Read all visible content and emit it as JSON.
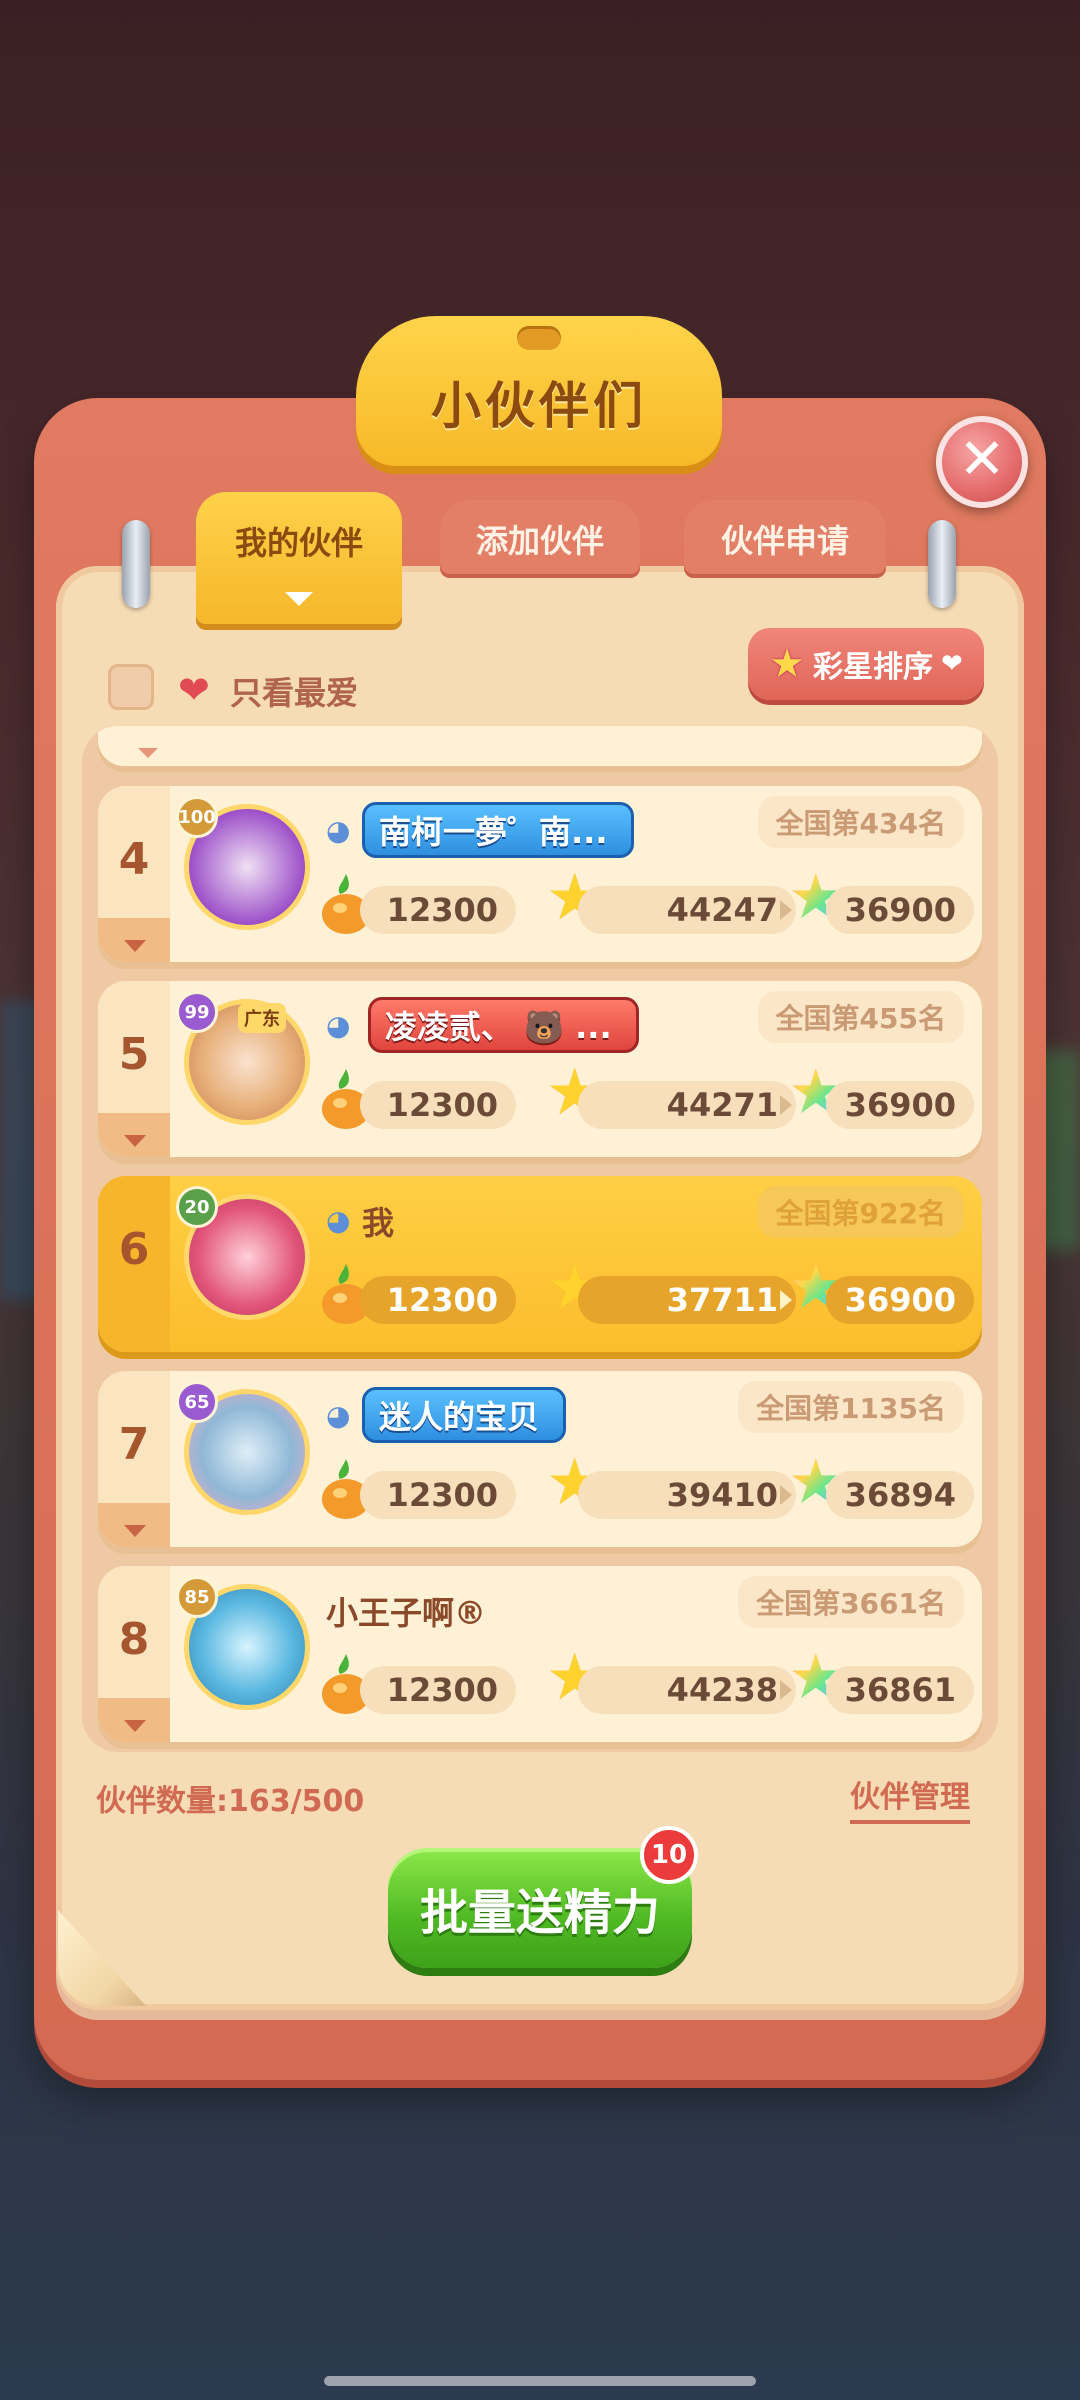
{
  "title": "小伙伴们",
  "close_label": "✕",
  "tabs": [
    {
      "label": "我的伙伴",
      "active": true
    },
    {
      "label": "添加伙伴",
      "active": false
    },
    {
      "label": "伙伴申请",
      "active": false
    }
  ],
  "filter": {
    "label": "只看最爱",
    "checked": false
  },
  "sort_button": {
    "label": "彩星排序"
  },
  "partners": [
    {
      "rank": "4",
      "level": "100",
      "name": "南柯一夢゜南...",
      "national_rank": "全国第434名",
      "energy": "12300",
      "stars": "44247",
      "rainbow_stars": "36900",
      "is_me": false
    },
    {
      "rank": "5",
      "level": "99",
      "name": "凌凌贰、 🐻 ...",
      "national_rank": "全国第455名",
      "energy": "12300",
      "stars": "44271",
      "rainbow_stars": "36900",
      "is_me": false,
      "region_tag": "广东"
    },
    {
      "rank": "6",
      "level": "20",
      "name": "我",
      "national_rank": "全国第922名",
      "energy": "12300",
      "stars": "37711",
      "rainbow_stars": "36900",
      "is_me": true
    },
    {
      "rank": "7",
      "level": "65",
      "name": "迷人的宝贝",
      "national_rank": "全国第1135名",
      "energy": "12300",
      "stars": "39410",
      "rainbow_stars": "36894",
      "is_me": false
    },
    {
      "rank": "8",
      "level": "85",
      "name": "小王子啊®",
      "national_rank": "全国第3661名",
      "energy": "12300",
      "stars": "44238",
      "rainbow_stars": "36861",
      "is_me": false
    }
  ],
  "partner_count": "伙伴数量:163/500",
  "partner_manage": "伙伴管理",
  "batch_button": {
    "label": "批量送精力",
    "badge": "10"
  },
  "colors": {
    "frame": "#d56a52",
    "panel": "#f6dcb4",
    "accent_yellow": "#fbbd2c",
    "green_button": "#4fb823"
  }
}
